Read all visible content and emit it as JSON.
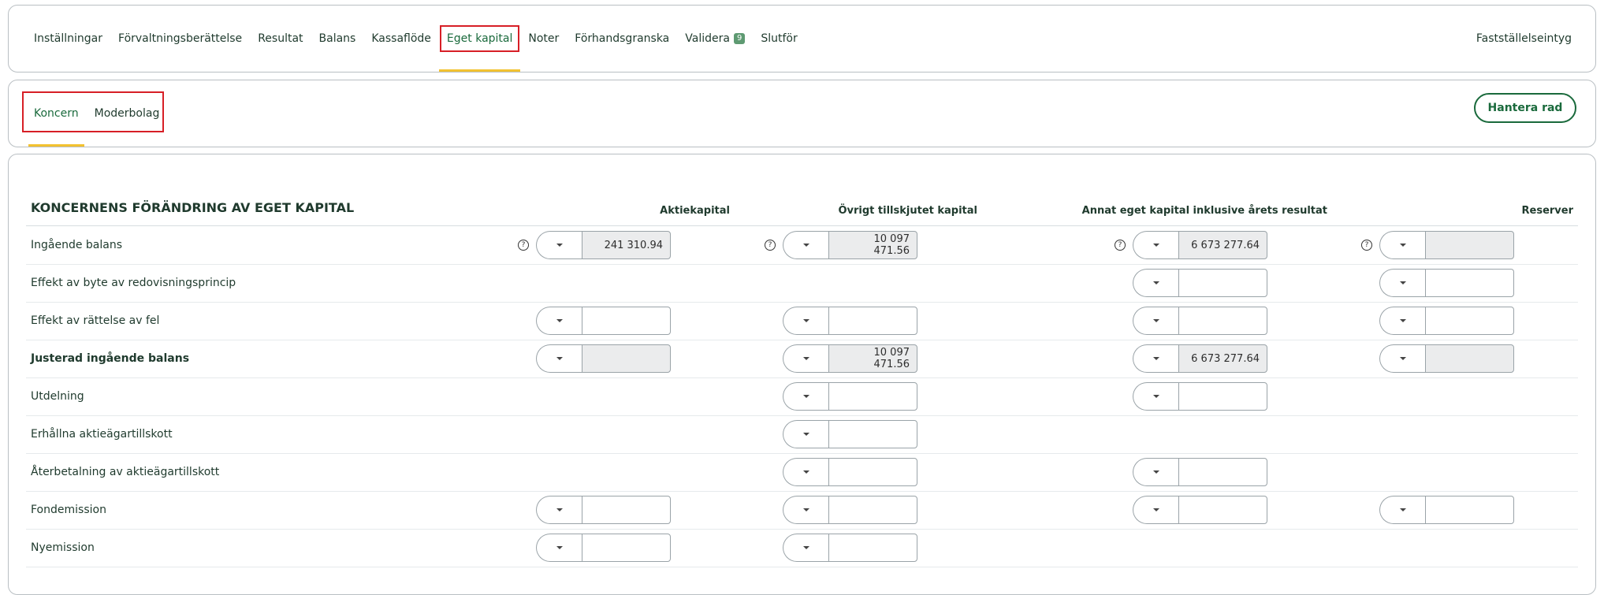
{
  "nav": {
    "tabs": [
      "Inställningar",
      "Förvaltningsberättelse",
      "Resultat",
      "Balans",
      "Kassaflöde",
      "Eget kapital",
      "Noter",
      "Förhandsgranska",
      "Validera",
      "Slutför"
    ],
    "validera_badge": "9",
    "right_link": "Fastställelseintyg"
  },
  "subnav": {
    "tabs": [
      "Koncern",
      "Moderbolag"
    ],
    "button": "Hantera rad"
  },
  "table": {
    "title": "KONCERNENS FÖRÄNDRING AV EGET KAPITAL",
    "columns": [
      "Aktiekapital",
      "Övrigt tillskjutet kapital",
      "Annat eget kapital inklusive årets resultat",
      "Reserver"
    ],
    "help_symbol": "?",
    "rows": [
      {
        "label": "Ingående balans",
        "values": [
          "241 310.94",
          "10 097 471.56",
          "6 673 277.64",
          ""
        ]
      },
      {
        "label": "Effekt av byte av redovisningsprincip",
        "values": [
          "",
          "",
          "",
          ""
        ]
      },
      {
        "label": "Effekt av rättelse av fel",
        "values": [
          "",
          "",
          "",
          ""
        ]
      },
      {
        "label": "Justerad ingående balans",
        "values": [
          "",
          "10 097 471.56",
          "6 673 277.64",
          ""
        ]
      },
      {
        "label": "Utdelning",
        "values": [
          "",
          "",
          "",
          ""
        ]
      },
      {
        "label": "Erhållna aktieägartillskott",
        "values": [
          "",
          "",
          "",
          ""
        ]
      },
      {
        "label": "Återbetalning av aktieägartillskott",
        "values": [
          "",
          "",
          "",
          ""
        ]
      },
      {
        "label": "Fondemission",
        "values": [
          "",
          "",
          "",
          ""
        ]
      },
      {
        "label": "Nyemission",
        "values": [
          "",
          "",
          "",
          ""
        ]
      }
    ]
  }
}
